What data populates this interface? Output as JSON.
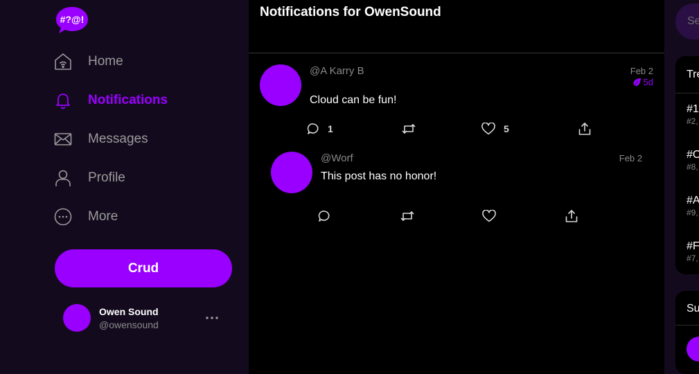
{
  "app": {
    "logo_text": "#?@!"
  },
  "sidebar": {
    "nav": [
      {
        "label": "Home",
        "icon": "home-icon",
        "active": false
      },
      {
        "label": "Notifications",
        "icon": "bell-icon",
        "active": true
      },
      {
        "label": "Messages",
        "icon": "envelope-icon",
        "active": false
      },
      {
        "label": "Profile",
        "icon": "user-icon",
        "active": false
      },
      {
        "label": "More",
        "icon": "more-circle-icon",
        "active": false
      }
    ],
    "post_button": "Crud",
    "account": {
      "name": "Owen Sound",
      "handle": "@owensound"
    }
  },
  "main": {
    "title": "Notifications for OwenSound",
    "posts": [
      {
        "handle": "@A Karry B",
        "date": "Feb 2",
        "age": "5d",
        "text": "Cloud can be fun!",
        "reply_count": "1",
        "like_count": "5"
      },
      {
        "handle": "@Worf",
        "date": "Feb 2",
        "text": "This post has no honor!"
      }
    ]
  },
  "right": {
    "search_placeholder": "Se",
    "trends_title": "Tre",
    "trends": [
      {
        "tag": "#1",
        "count": "#2,"
      },
      {
        "tag": "#O",
        "count": "#8,"
      },
      {
        "tag": "#A",
        "count": "#9,"
      },
      {
        "tag": "#F",
        "count": "#7,"
      }
    ],
    "suggest_title": "Su"
  },
  "colors": {
    "accent": "#9900ff",
    "sidebar_bg": "#140a1e",
    "muted_text": "#8a8a8a",
    "main_bg": "#000000"
  }
}
